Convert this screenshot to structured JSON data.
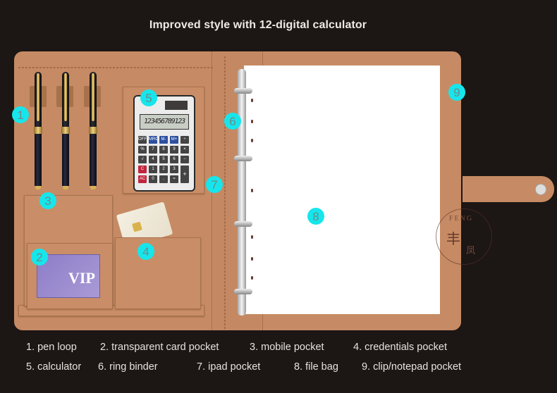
{
  "title": "Improved style with 12-digital calculator",
  "calculator": {
    "display": "123456789123",
    "keys": [
      "OFF",
      "MRC",
      "M-",
      "M+",
      "÷",
      "%",
      "7",
      "8",
      "9",
      "×",
      "√",
      "4",
      "5",
      "6",
      "−",
      "C",
      "1",
      "2",
      "3",
      "+",
      "AC",
      "0",
      ".",
      "="
    ]
  },
  "vip_card": {
    "text": "VIP"
  },
  "watermark": {
    "line1": "FENG",
    "line2": "丰",
    "line3": "凤"
  },
  "badges": [
    "1",
    "2",
    "3",
    "4",
    "5",
    "6",
    "7",
    "8",
    "9"
  ],
  "legend": {
    "row1": [
      "1. pen loop",
      "2. transparent card pocket",
      "3. mobile pocket",
      "4. credentials pocket"
    ],
    "row2": [
      "5. calculator",
      "6. ring binder",
      "7. ipad pocket",
      "8. file bag",
      "9. clip/notepad pocket"
    ]
  },
  "colors": {
    "background": "#1c1615",
    "leather": "#c68b64",
    "badge": "#16e6ec",
    "text": "#e8e2dc"
  }
}
